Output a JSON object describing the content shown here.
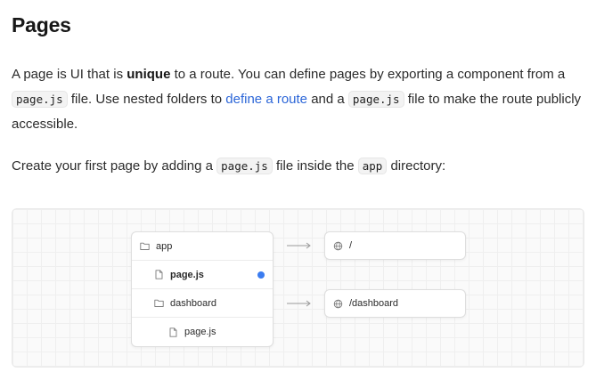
{
  "heading": "Pages",
  "para1": {
    "t1": "A page is UI that is ",
    "strong": "unique",
    "t2": " to a route. You can define pages by exporting a component from a ",
    "code1": "page.js",
    "t3": " file. Use nested folders to ",
    "link": "define a route",
    "t4": " and a ",
    "code2": "page.js",
    "t5": " file to make the route publicly accessible."
  },
  "para2": {
    "t1": "Create your first page by adding a ",
    "code1": "page.js",
    "t2": " file inside the ",
    "code2": "app",
    "t3": " directory:"
  },
  "diagram": {
    "tree": [
      {
        "label": "app",
        "icon": "folder-icon"
      },
      {
        "label": "page.js",
        "icon": "file-icon",
        "highlighted": true
      },
      {
        "label": "dashboard",
        "icon": "folder-icon"
      },
      {
        "label": "page.js",
        "icon": "file-icon"
      }
    ],
    "routes": [
      {
        "label": "/",
        "icon": "globe-icon"
      },
      {
        "label": "/dashboard",
        "icon": "globe-icon"
      }
    ],
    "colors": {
      "highlight_dot": "#3b7cf0",
      "link": "#2c66d8"
    }
  }
}
